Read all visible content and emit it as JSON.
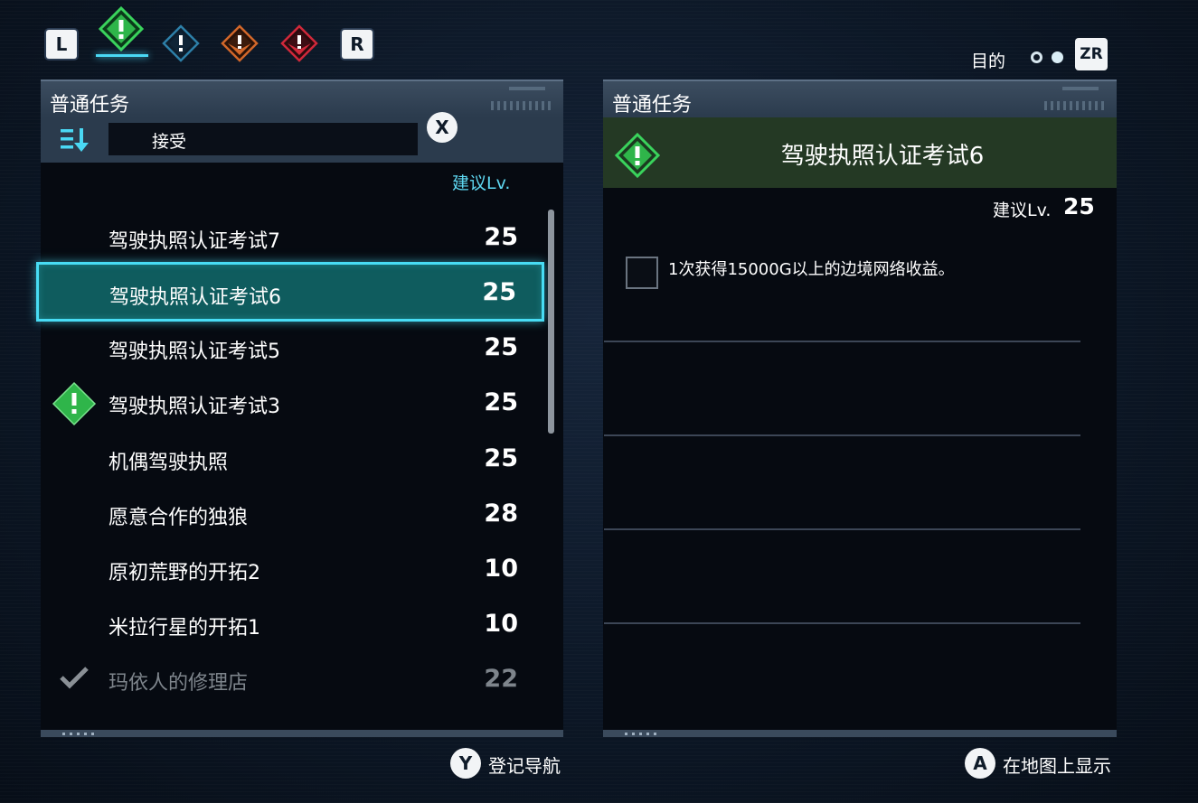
{
  "top_bar": {
    "left_shoulder": "L",
    "right_shoulder": "R",
    "tabs": [
      {
        "icon": "alert-diamond-green-icon",
        "color": "#29b34a",
        "active": true
      },
      {
        "icon": "alert-diamond-blue-icon",
        "color": "#2d7fa8",
        "active": false
      },
      {
        "icon": "alert-diamond-orange-icon",
        "color": "#d2672a",
        "active": false
      },
      {
        "icon": "alert-diamond-red-icon",
        "color": "#d0283a",
        "active": false
      }
    ],
    "objective_label": "目的",
    "zr_button": "ZR"
  },
  "left_panel": {
    "title": "普通任务",
    "filter_text": "接受",
    "x_button": "X",
    "rec_level_header": "建议Lv.",
    "quests": [
      {
        "name": "驾驶执照认证考试7",
        "level": "25"
      },
      {
        "name": "驾驶执照认证考试6",
        "level": "25",
        "selected": true
      },
      {
        "name": "驾驶执照认证考试5",
        "level": "25"
      },
      {
        "name": "驾驶执照认证考试3",
        "level": "25",
        "badge": "alert-diamond-green-icon"
      },
      {
        "name": "机偶驾驶执照",
        "level": "25"
      },
      {
        "name": "愿意合作的独狼",
        "level": "28"
      },
      {
        "name": "原初荒野的开拓2",
        "level": "10"
      },
      {
        "name": "米拉行星的开拓1",
        "level": "10"
      },
      {
        "name": "玛依人的修理店",
        "level": "22",
        "completed": true
      }
    ]
  },
  "right_panel": {
    "title": "普通任务",
    "quest_title": "驾驶执照认证考试6",
    "rec_level_label": "建议Lv.",
    "rec_level_value": "25",
    "objectives": [
      {
        "text": "1次获得15000G以上的边境网络收益。",
        "done": false
      }
    ]
  },
  "bottom": {
    "y_button": "Y",
    "y_label": "登记导航",
    "a_button": "A",
    "a_label": "在地图上显示"
  },
  "colors": {
    "accent_cyan": "#48dcf4",
    "selected_row": "#0f5c5e",
    "quest_header_green": "#243924"
  }
}
